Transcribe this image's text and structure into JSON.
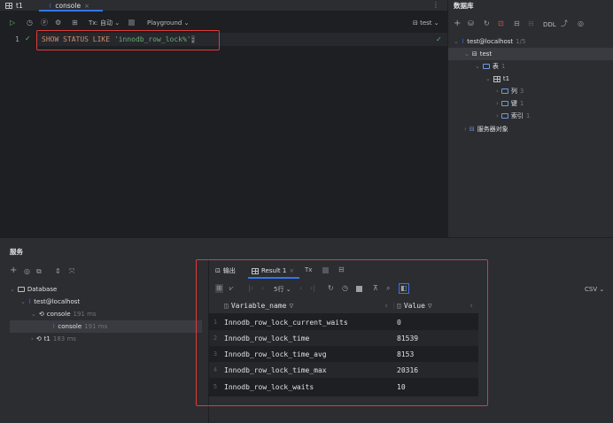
{
  "tabs": [
    {
      "label": "t1"
    },
    {
      "label": "console"
    }
  ],
  "right_panel_title": "数据库",
  "editor_toolbar": {
    "tx_label": "Tx: 自动",
    "playground_label": "Playground",
    "session_label": "test"
  },
  "editor": {
    "line_number": "1",
    "sql_keyword": "SHOW STATUS LIKE ",
    "sql_string": "'innodb_row_lock%'",
    "sql_end": ";"
  },
  "db_toolbar": {
    "ddl_label": "DDL"
  },
  "db_tree": {
    "connection": "test@localhost",
    "connection_count": "1/5",
    "schema": "test",
    "tables_folder": "表",
    "tables_count": "1",
    "table": "t1",
    "columns": "列",
    "columns_count": "3",
    "keys": "键",
    "keys_count": "1",
    "indexes": "索引",
    "indexes_count": "1",
    "server_objects": "服务器对象"
  },
  "services_title": "服务",
  "services_tree": {
    "database": "Database",
    "connection": "test@localhost",
    "console_group": "console",
    "console_group_time": "191 ms",
    "console_item": "console",
    "console_item_time": "191 ms",
    "t1": "t1",
    "t1_time": "183 ms"
  },
  "result_tabs": {
    "output": "输出",
    "result": "Result 1",
    "tx": "Tx"
  },
  "result_toolbar": {
    "rows_label": "5行",
    "csv_label": "CSV"
  },
  "grid": {
    "columns": [
      "Variable_name",
      "Value"
    ],
    "rows": [
      {
        "n": "1",
        "name": "Innodb_row_lock_current_waits",
        "value": "0"
      },
      {
        "n": "2",
        "name": "Innodb_row_lock_time",
        "value": "81539"
      },
      {
        "n": "3",
        "name": "Innodb_row_lock_time_avg",
        "value": "8153"
      },
      {
        "n": "4",
        "name": "Innodb_row_lock_time_max",
        "value": "20316"
      },
      {
        "n": "5",
        "name": "Innodb_row_lock_waits",
        "value": "10"
      }
    ]
  },
  "colors": {
    "accent": "#3574f0",
    "highlight": "#e03a3a",
    "bg": "#1e1f22",
    "panel": "#2b2d30"
  }
}
